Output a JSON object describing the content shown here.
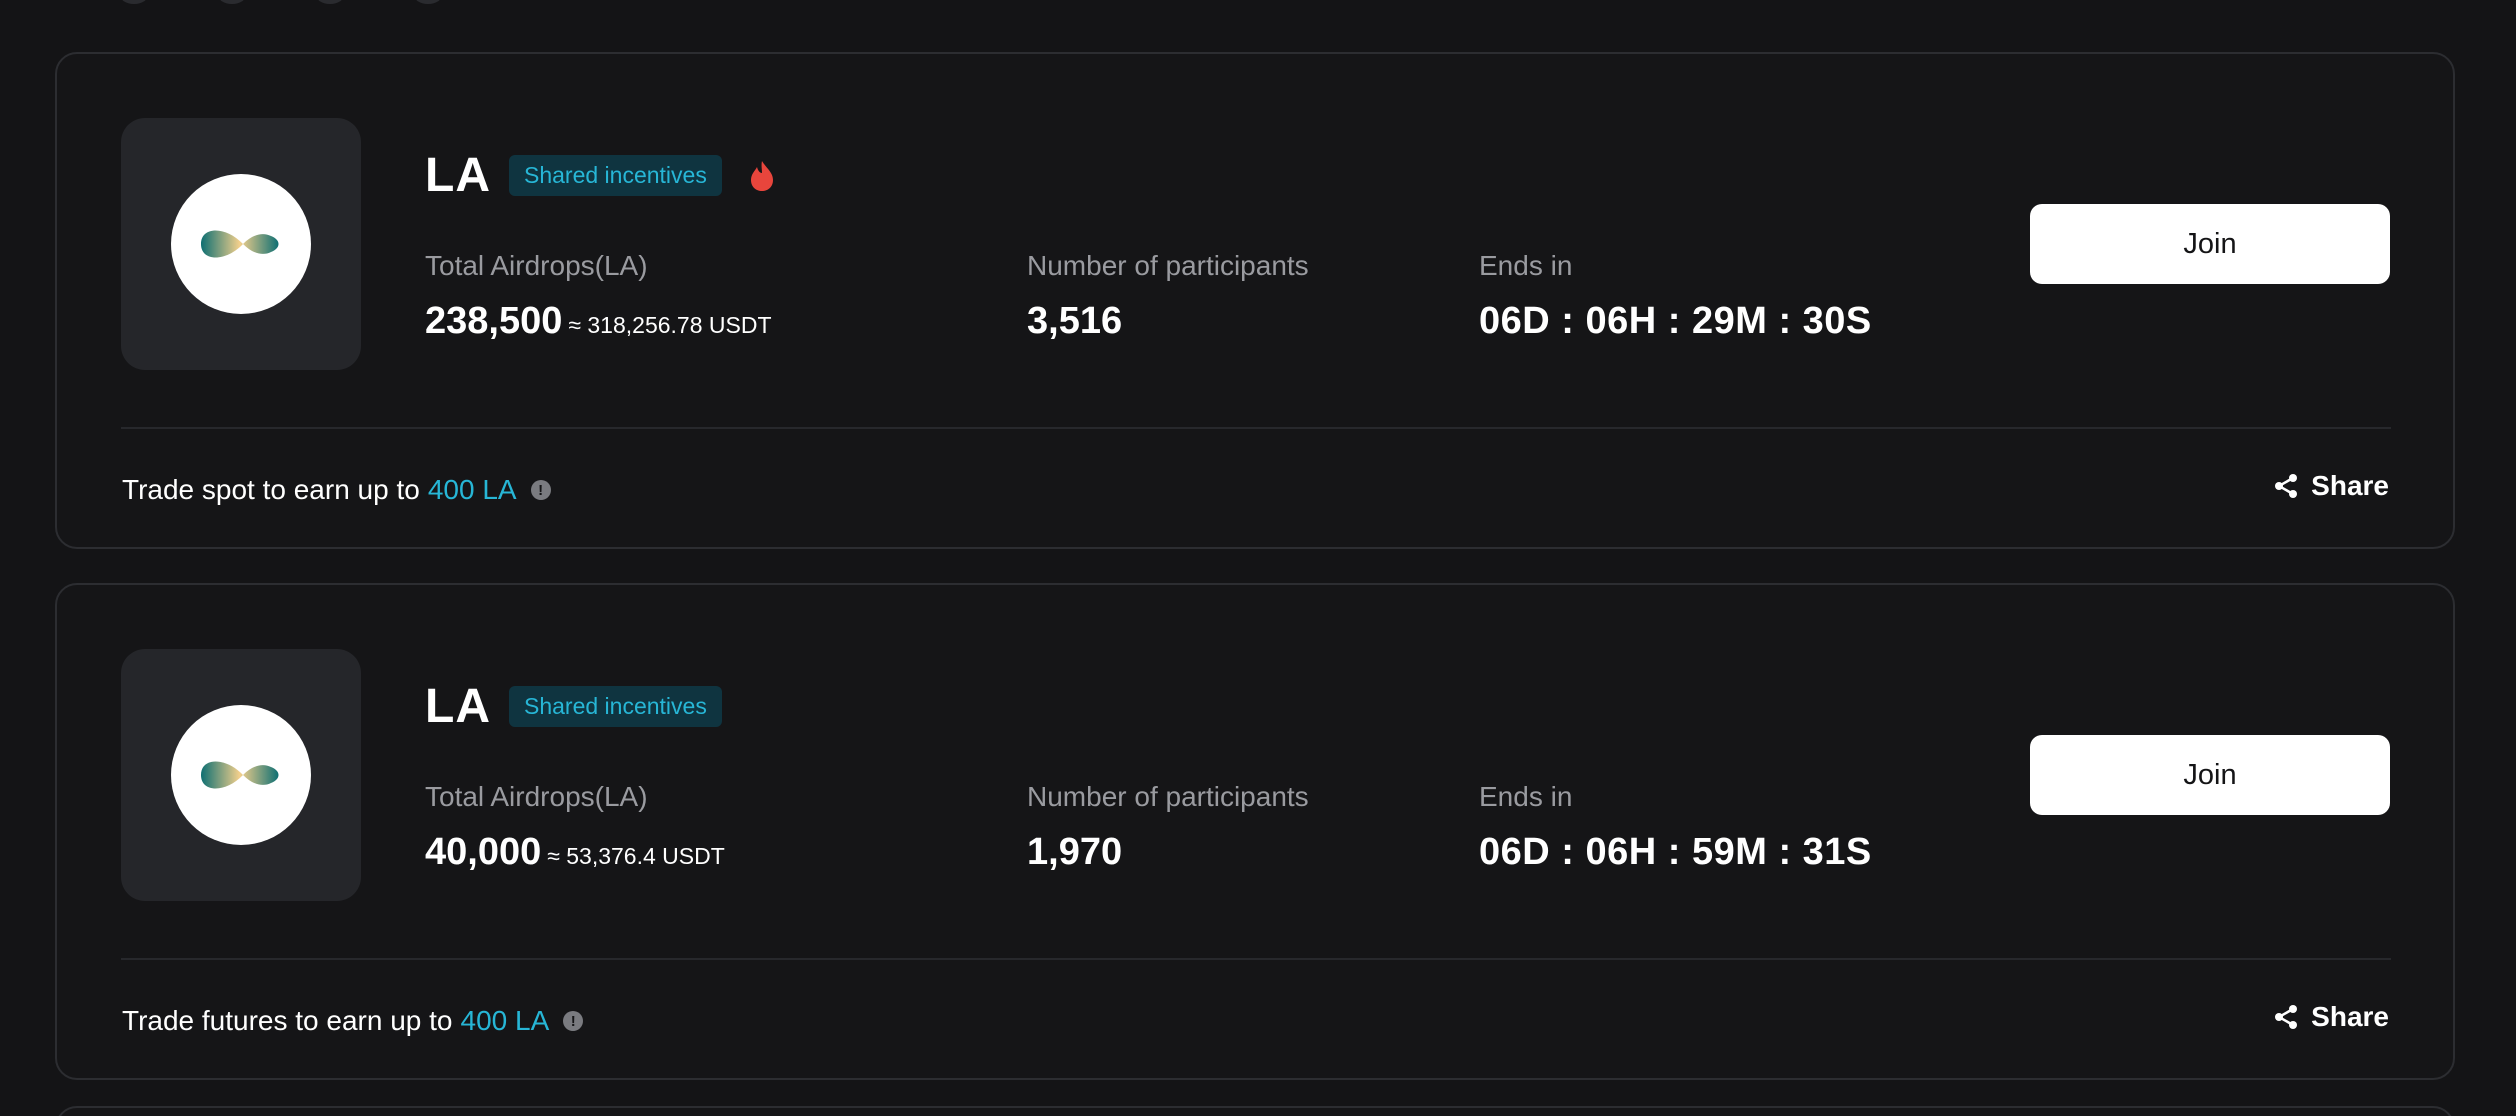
{
  "cards": [
    {
      "token": "LA",
      "tag": "Shared incentives",
      "hot": true,
      "airdrop_label": "Total Airdrops(LA)",
      "airdrop_value": "238,500",
      "airdrop_usdt": "≈ 318,256.78 USDT",
      "participants_label": "Number of participants",
      "participants_value": "3,516",
      "ends_label": "Ends in",
      "ends_value": "06D : 06H : 29M : 30S",
      "join_label": "Join",
      "footer_prefix": "Trade spot to earn up to",
      "footer_reward": "400 LA",
      "share_label": "Share"
    },
    {
      "token": "LA",
      "tag": "Shared incentives",
      "hot": false,
      "airdrop_label": "Total Airdrops(LA)",
      "airdrop_value": "40,000",
      "airdrop_usdt": "≈ 53,376.4 USDT",
      "participants_label": "Number of participants",
      "participants_value": "1,970",
      "ends_label": "Ends in",
      "ends_value": "06D : 06H : 59M : 31S",
      "join_label": "Join",
      "footer_prefix": "Trade futures to earn up to",
      "footer_reward": "400 LA",
      "share_label": "Share"
    }
  ],
  "icons": {
    "logo": "la-token-logo-icon",
    "hot": "fire-icon",
    "info": "info-icon",
    "share": "share-icon"
  },
  "colors": {
    "background": "#141416",
    "card_border": "#2c2d31",
    "accent": "#27b6d6",
    "tag_bg": "#0f3440",
    "hot": "#e8453c",
    "button_bg": "#ffffff"
  }
}
